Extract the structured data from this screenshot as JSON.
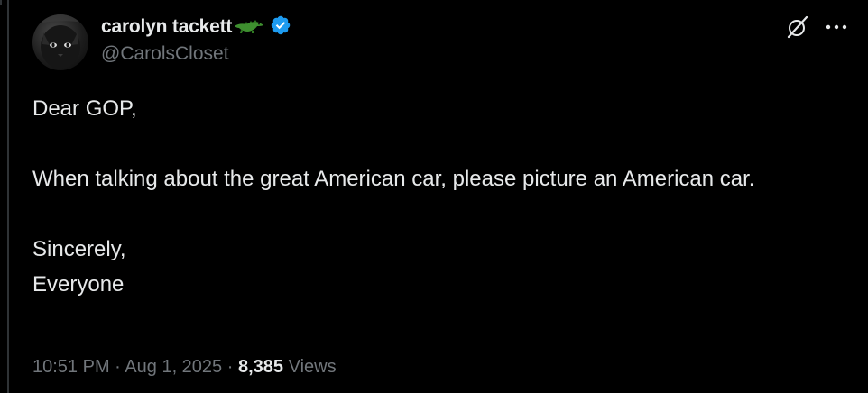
{
  "post": {
    "author": {
      "display_name": "carolyn tackett",
      "handle": "@CarolsCloset",
      "name_emoji": "crocodile-emoji",
      "verified": true,
      "verified_color": "#1d9bf0"
    },
    "body": {
      "greeting": "Dear GOP,",
      "message": "When talking about the great American car, please picture an American car.",
      "signoff": "Sincerely,",
      "signature": "Everyone"
    },
    "meta": {
      "time": "10:51 PM",
      "separator": "·",
      "date": "Aug 1, 2025",
      "views_count": "8,385",
      "views_label": "Views"
    },
    "actions": {
      "grok_icon": "grok-icon",
      "more_icon": "more-icon"
    }
  },
  "colors": {
    "background": "#000000",
    "text_primary": "#e7e9ea",
    "text_secondary": "#71767b",
    "accent": "#1d9bf0"
  }
}
